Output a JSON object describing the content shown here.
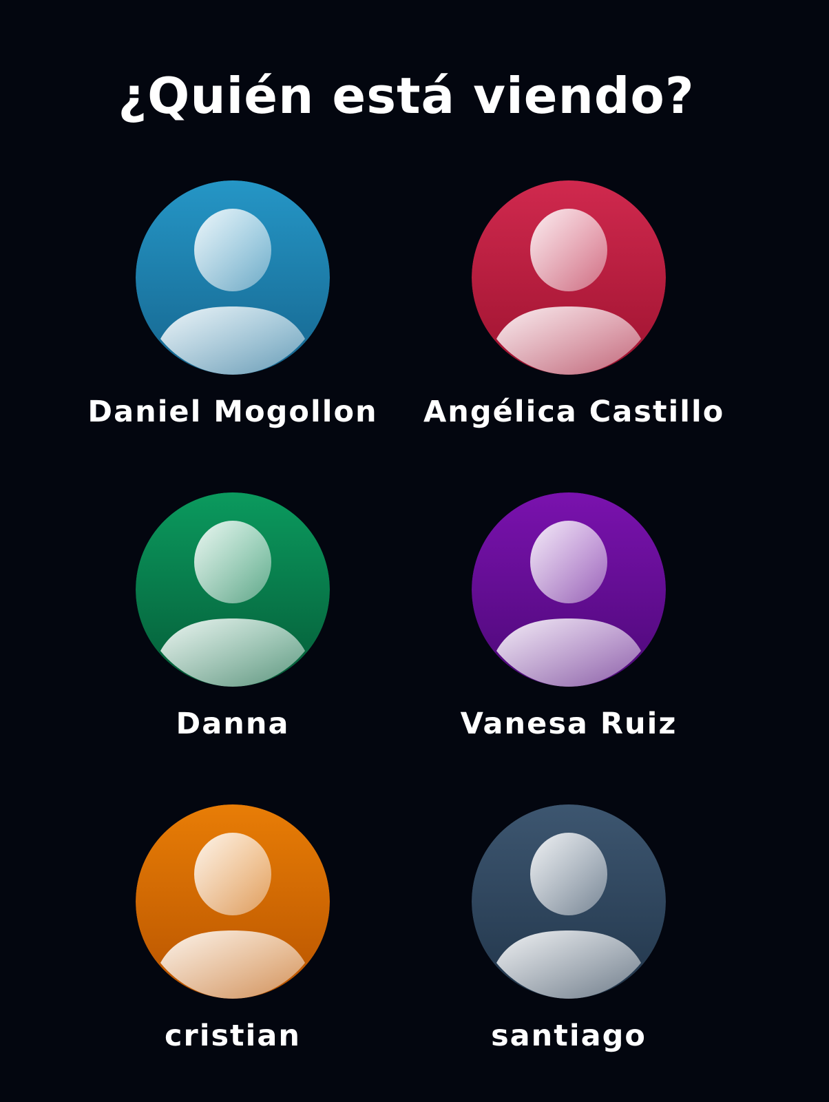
{
  "header": {
    "title": "¿Quién está viendo?"
  },
  "profiles": [
    {
      "name": "Daniel Mogollon",
      "icon": "person-avatar-icon",
      "color_top": "#2596c6",
      "color_bottom": "#16668f"
    },
    {
      "name": "Angélica Castillo",
      "icon": "person-avatar-icon",
      "color_top": "#d0294e",
      "color_bottom": "#9e1330"
    },
    {
      "name": "Danna",
      "icon": "person-avatar-icon",
      "color_top": "#0b9a5e",
      "color_bottom": "#055c38"
    },
    {
      "name": "Vanesa Ruiz",
      "icon": "person-avatar-icon",
      "color_top": "#7a12ae",
      "color_bottom": "#4d0978"
    },
    {
      "name": "cristian",
      "icon": "person-avatar-icon",
      "color_top": "#e87d06",
      "color_bottom": "#b85400"
    },
    {
      "name": "santiago",
      "icon": "person-avatar-icon",
      "color_top": "#3d5670",
      "color_bottom": "#22364b"
    }
  ]
}
